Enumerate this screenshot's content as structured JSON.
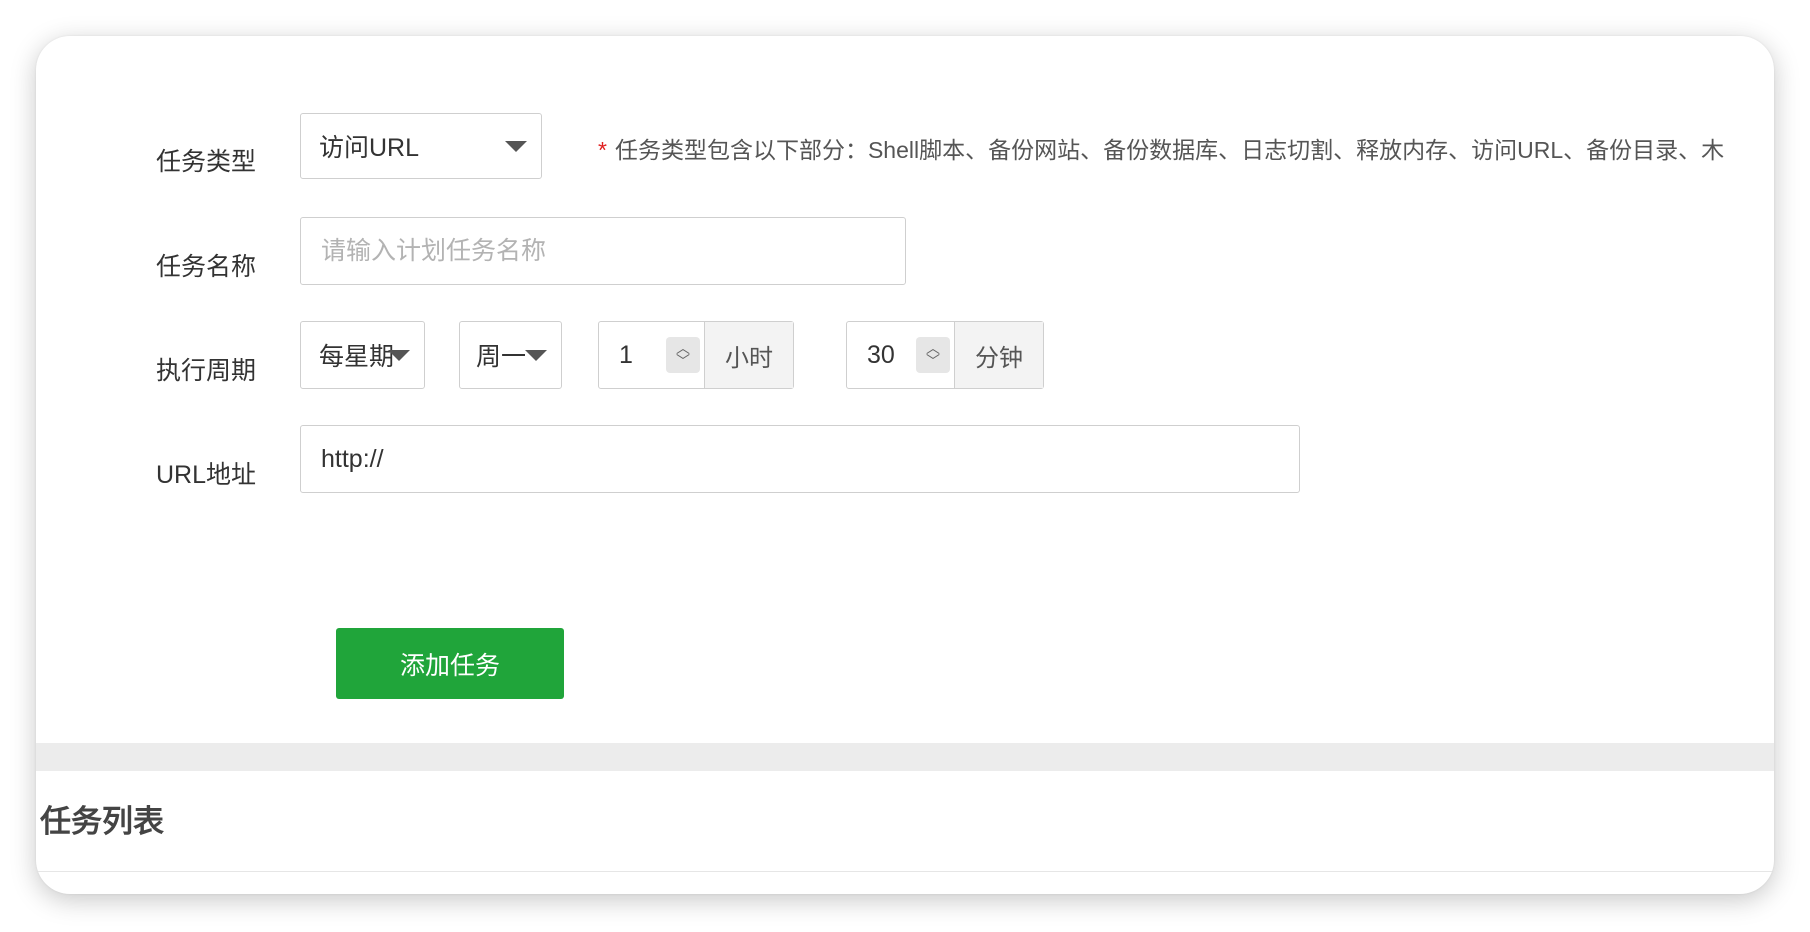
{
  "form": {
    "task_type": {
      "label": "任务类型",
      "selected": "访问URL",
      "hint_star": "*",
      "hint": "任务类型包含以下部分：Shell脚本、备份网站、备份数据库、日志切割、释放内存、访问URL、备份目录、木"
    },
    "task_name": {
      "label": "任务名称",
      "value": "",
      "placeholder": "请输入计划任务名称"
    },
    "schedule": {
      "label": "执行周期",
      "period": "每星期",
      "weekday": "周一",
      "hour": "1",
      "hour_unit": "小时",
      "minute": "30",
      "minute_unit": "分钟"
    },
    "url": {
      "label": "URL地址",
      "value": "http://"
    },
    "submit_label": "添加任务"
  },
  "task_list": {
    "title": "任务列表"
  },
  "colors": {
    "primary_green": "#20a53a",
    "required_red": "#e02020",
    "border": "#cfcfcf"
  },
  "icons": {
    "dropdown": "caret-down-icon",
    "spinner": "spinner-updown-icon"
  }
}
